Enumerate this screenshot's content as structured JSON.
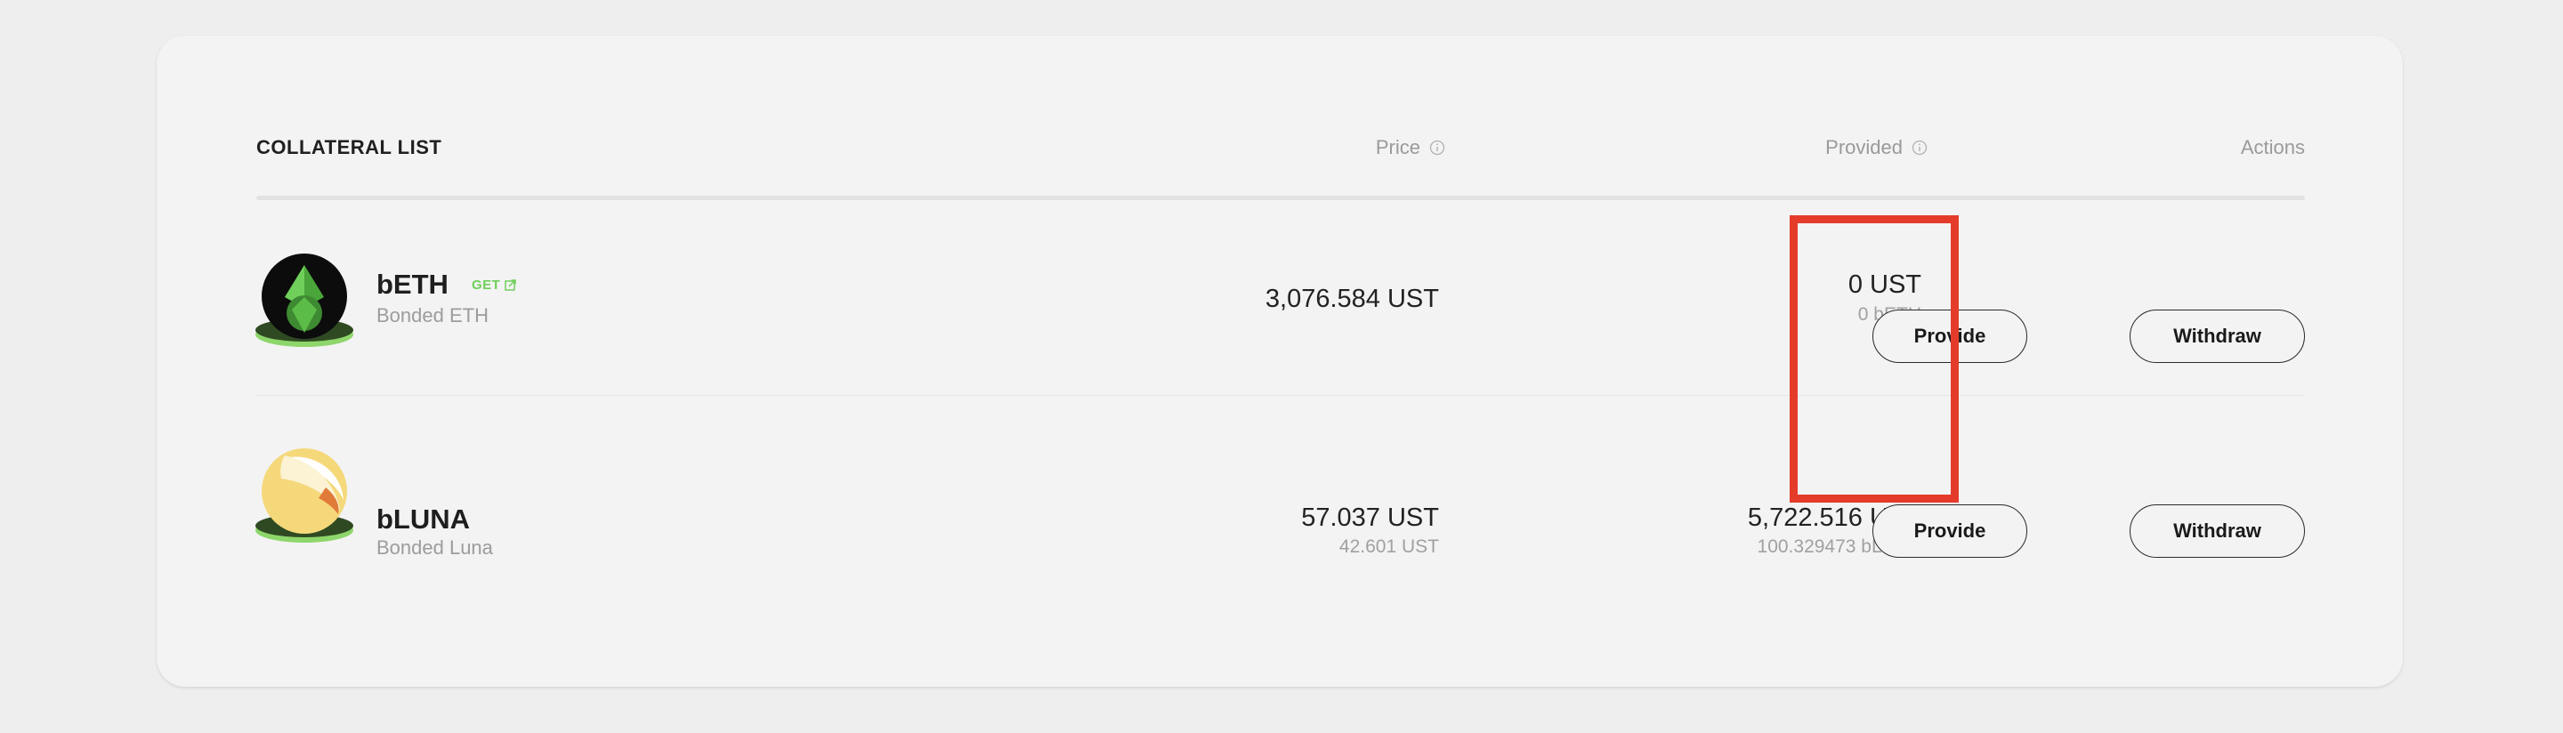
{
  "table": {
    "title": "COLLATERAL LIST",
    "columns": {
      "price": "Price",
      "provided": "Provided",
      "actions": "Actions"
    }
  },
  "rows": [
    {
      "symbol": "bETH",
      "name": "Bonded ETH",
      "badge": "GET",
      "icon": "beth-token-icon",
      "price": "3,076.584 UST",
      "price_sub": "",
      "provided": "0 UST",
      "provided_sub": "0 bETH",
      "provide_label": "Provide",
      "withdraw_label": "Withdraw"
    },
    {
      "symbol": "bLUNA",
      "name": "Bonded Luna",
      "icon": "bluna-token-icon",
      "price": "57.037 UST",
      "price_sub": "42.601 UST",
      "provided": "5,722.516 UST",
      "provided_sub": "100.329473 bLUNA",
      "provide_label": "Provide",
      "withdraw_label": "Withdraw"
    }
  ],
  "colors": {
    "highlight": "#e53b2b",
    "accent_green": "#6fcf5a",
    "card_bg": "#f3f3f3"
  }
}
